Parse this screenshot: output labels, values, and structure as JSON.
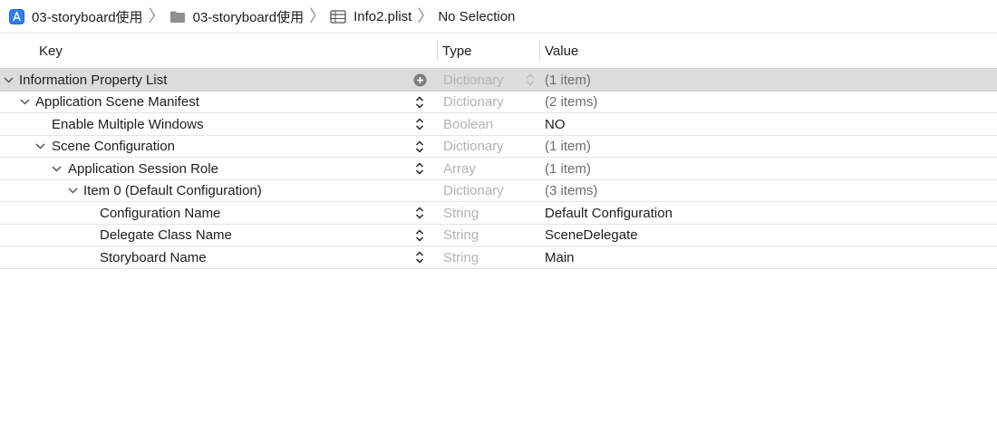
{
  "breadcrumb": {
    "items": [
      {
        "label": "03-storyboard使用",
        "icon": "app-project-icon"
      },
      {
        "label": "03-storyboard使用",
        "icon": "folder-icon"
      },
      {
        "label": "Info2.plist",
        "icon": "plist-table-icon"
      },
      {
        "label": "No Selection",
        "icon": ""
      }
    ]
  },
  "columns": {
    "key": "Key",
    "type": "Type",
    "value": "Value"
  },
  "rows": [
    {
      "key": "Information Property List",
      "type": "Dictionary",
      "value": "(1 item)"
    },
    {
      "key": "Application Scene Manifest",
      "type": "Dictionary",
      "value": "(2 items)"
    },
    {
      "key": "Enable Multiple Windows",
      "type": "Boolean",
      "value": "NO"
    },
    {
      "key": "Scene Configuration",
      "type": "Dictionary",
      "value": "(1 item)"
    },
    {
      "key": "Application Session Role",
      "type": "Array",
      "value": "(1 item)"
    },
    {
      "key": "Item 0 (Default Configuration)",
      "type": "Dictionary",
      "value": "(3 items)"
    },
    {
      "key": "Configuration Name",
      "type": "String",
      "value": "Default Configuration"
    },
    {
      "key": "Delegate Class Name",
      "type": "String",
      "value": "SceneDelegate"
    },
    {
      "key": "Storyboard Name",
      "type": "String",
      "value": "Main"
    }
  ]
}
